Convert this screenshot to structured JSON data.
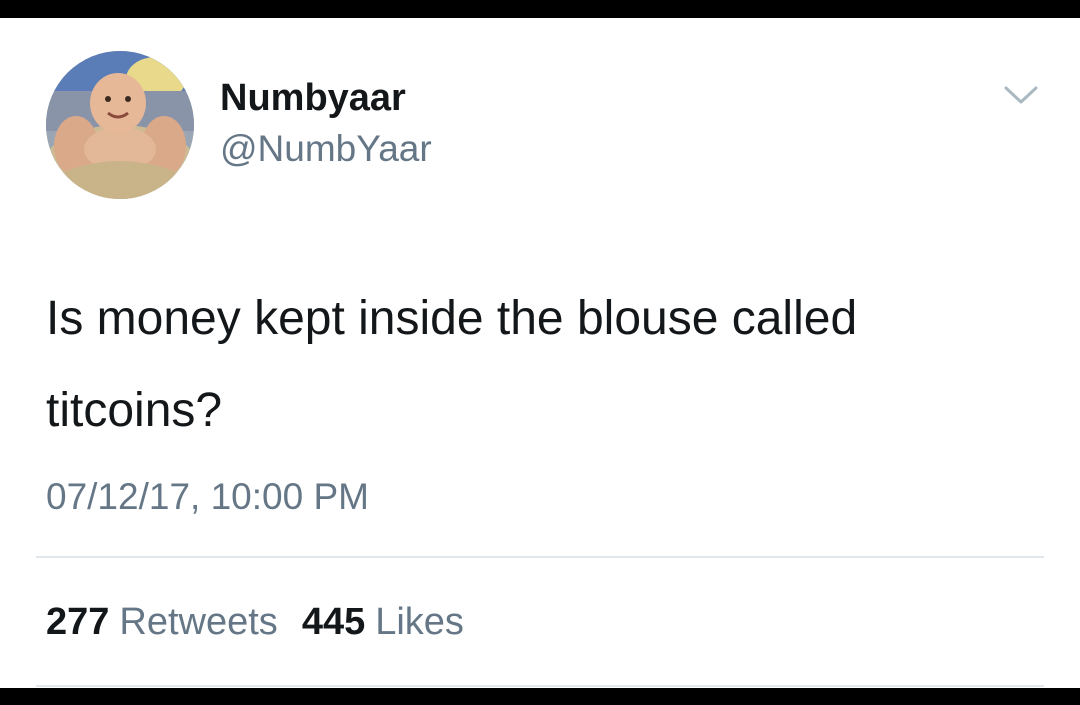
{
  "tweet": {
    "display_name": "Numbyaar",
    "handle": "@NumbYaar",
    "text": "Is money kept inside the blouse called titcoins?",
    "timestamp": "07/12/17, 10:00 PM",
    "retweets": {
      "count": "277",
      "label": "Retweets"
    },
    "likes": {
      "count": "445",
      "label": "Likes"
    }
  },
  "icons": {
    "menu": "chevron-down-icon",
    "avatar": "baby-photo"
  },
  "colors": {
    "background": "#ffffff",
    "frame": "#000000",
    "primary_text": "#14171a",
    "secondary_text": "#657786",
    "divider": "#e1e8ed"
  }
}
